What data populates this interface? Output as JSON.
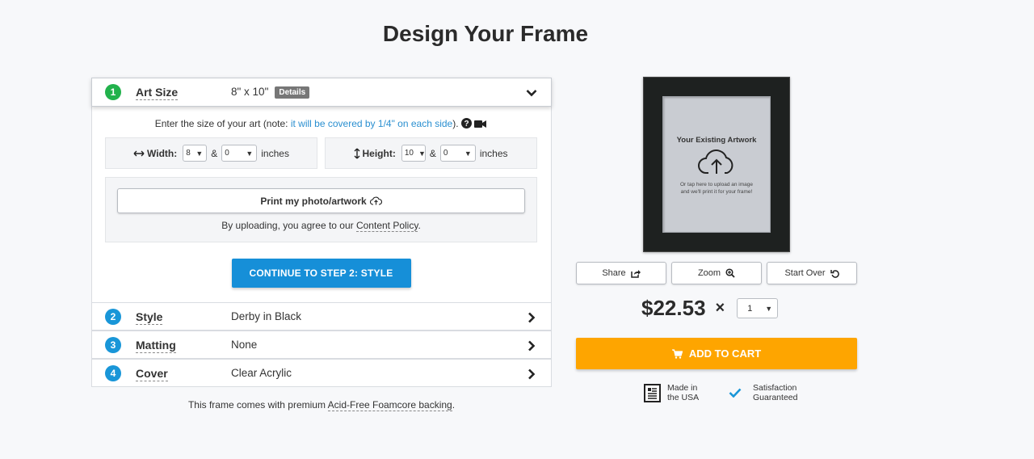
{
  "page": {
    "title": "Design Your Frame"
  },
  "steps": [
    {
      "num": "1",
      "title": "Art Size",
      "value": "8\" x 10\"",
      "badge": "Details"
    },
    {
      "num": "2",
      "title": "Style",
      "value": "Derby in Black"
    },
    {
      "num": "3",
      "title": "Matting",
      "value": "None"
    },
    {
      "num": "4",
      "title": "Cover",
      "value": "Clear Acrylic"
    }
  ],
  "art_size": {
    "instruction_prefix": "Enter the size of your art (note: ",
    "instruction_link": "it will be covered by 1/4\" on each side",
    "instruction_suffix": ").",
    "width": {
      "label": "Width:",
      "inches": "8",
      "fraction": "0",
      "unit": "inches"
    },
    "height": {
      "label": "Height:",
      "inches": "10",
      "fraction": "0",
      "unit": "inches"
    },
    "amp": "&",
    "upload_label": "Print my photo/artwork",
    "agree_prefix": "By uploading, you agree to our ",
    "agree_link": "Content Policy",
    "agree_suffix": ".",
    "continue_label": "CONTINUE TO STEP 2: STYLE"
  },
  "backing": {
    "prefix": "This frame comes with premium ",
    "link": "Acid-Free Foamcore backing",
    "suffix": "."
  },
  "preview": {
    "art_title": "Your Existing Artwork",
    "art_hint_1": "Or tap here to upload an image",
    "art_hint_2": "and we'll print it for your frame!",
    "frame_color": "#1e2120"
  },
  "actions": {
    "share": "Share",
    "zoom": "Zoom",
    "start_over": "Start Over"
  },
  "pricing": {
    "price": "$22.53",
    "times": "×",
    "quantity": "1"
  },
  "cart": {
    "label": "ADD TO CART",
    "color": "#fea500"
  },
  "trust": {
    "usa_line1": "Made in",
    "usa_line2": "the USA",
    "sat_line1": "Satisfaction",
    "sat_line2": "Guaranteed"
  },
  "colors": {
    "primary": "#168fd8",
    "step_active": "#22b24c",
    "step": "#1996d8"
  }
}
